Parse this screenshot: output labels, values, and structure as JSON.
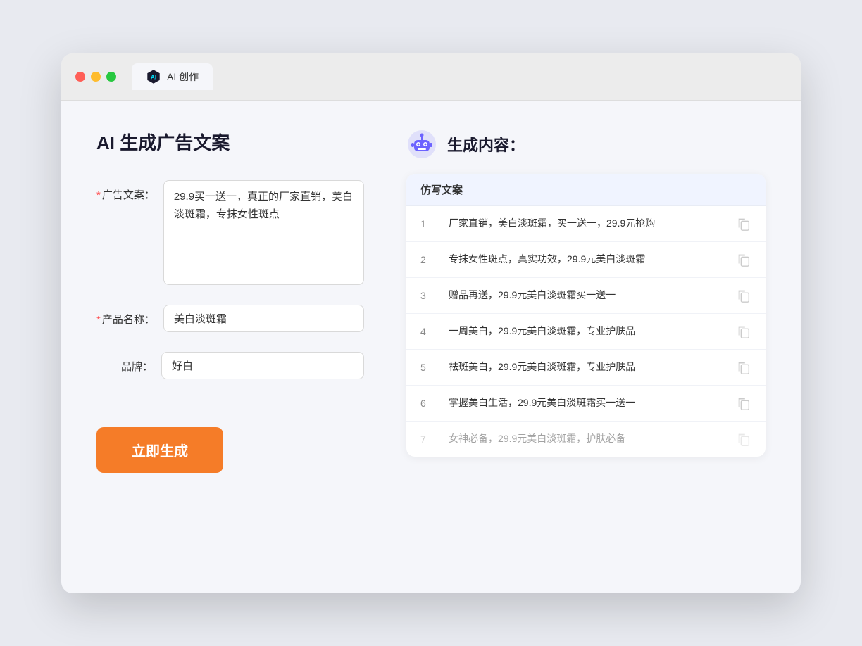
{
  "browser": {
    "tab_label": "AI 创作"
  },
  "page": {
    "title": "AI 生成广告文案",
    "result_title": "生成内容："
  },
  "form": {
    "ad_label": "广告文案：",
    "ad_required": true,
    "ad_value": "29.9买一送一，真正的厂家直销，美白淡斑霜，专抹女性斑点",
    "product_label": "产品名称：",
    "product_required": true,
    "product_value": "美白淡斑霜",
    "brand_label": "品牌：",
    "brand_required": false,
    "brand_value": "好白",
    "generate_button": "立即生成"
  },
  "result": {
    "table_header": "仿写文案",
    "items": [
      {
        "id": 1,
        "text": "厂家直销，美白淡斑霜，买一送一，29.9元抢购",
        "dimmed": false
      },
      {
        "id": 2,
        "text": "专抹女性斑点，真实功效，29.9元美白淡斑霜",
        "dimmed": false
      },
      {
        "id": 3,
        "text": "赠品再送，29.9元美白淡斑霜买一送一",
        "dimmed": false
      },
      {
        "id": 4,
        "text": "一周美白，29.9元美白淡斑霜，专业护肤品",
        "dimmed": false
      },
      {
        "id": 5,
        "text": "祛斑美白，29.9元美白淡斑霜，专业护肤品",
        "dimmed": false
      },
      {
        "id": 6,
        "text": "掌握美白生活，29.9元美白淡斑霜买一送一",
        "dimmed": false
      },
      {
        "id": 7,
        "text": "女神必备，29.9元美白淡斑霜，护肤必备",
        "dimmed": true
      }
    ]
  }
}
